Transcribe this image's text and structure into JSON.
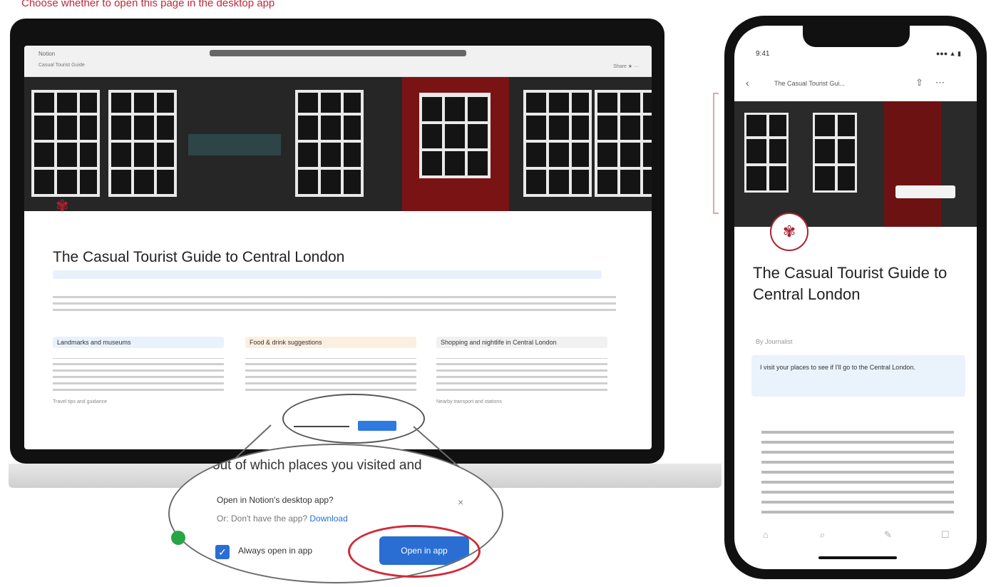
{
  "caption": "Choose whether to open this page in the desktop app",
  "desktop": {
    "browser": {
      "tab_text": "Notion",
      "nav_text": "Casual Tourist Guide",
      "actions_text": "Share  ★  ···"
    },
    "page": {
      "icon": "✾",
      "title": "The Casual Tourist Guide to Central London",
      "columns": [
        {
          "heading": "Landmarks and museums",
          "color": "#e9f1fb",
          "footer": "Travel tips and guidance"
        },
        {
          "heading": "Food & drink suggestions",
          "color": "#fbf0df",
          "footer": ""
        },
        {
          "heading": "Shopping and nightlife in Central London",
          "color": "#f1f1f1",
          "footer": "Nearby transport and stations"
        }
      ]
    },
    "magnifier": {
      "context_line": "out of which places you visited and",
      "prompt_title": "Open in Notion's desktop app?",
      "download_prefix": "Or: Don't have the app?",
      "download_link": "Download",
      "always_open_label": "Always open in app",
      "open_button": "Open in app"
    }
  },
  "mobile": {
    "status_time": "9:41",
    "status_right": "●●● ▲ ▮",
    "tab_label": "The Casual Tourist Gui...",
    "page_title": "The Casual Tourist Guide to Central London",
    "meta": "By Journalist",
    "callout": "I visit your places to see if I'll go to the Central London."
  },
  "icons": {
    "back": "‹",
    "share": "⇧",
    "more": "⋯",
    "close": "×",
    "check": "✓",
    "bottom_bar": [
      "⌂",
      "⌕",
      "✎",
      "☐"
    ]
  }
}
